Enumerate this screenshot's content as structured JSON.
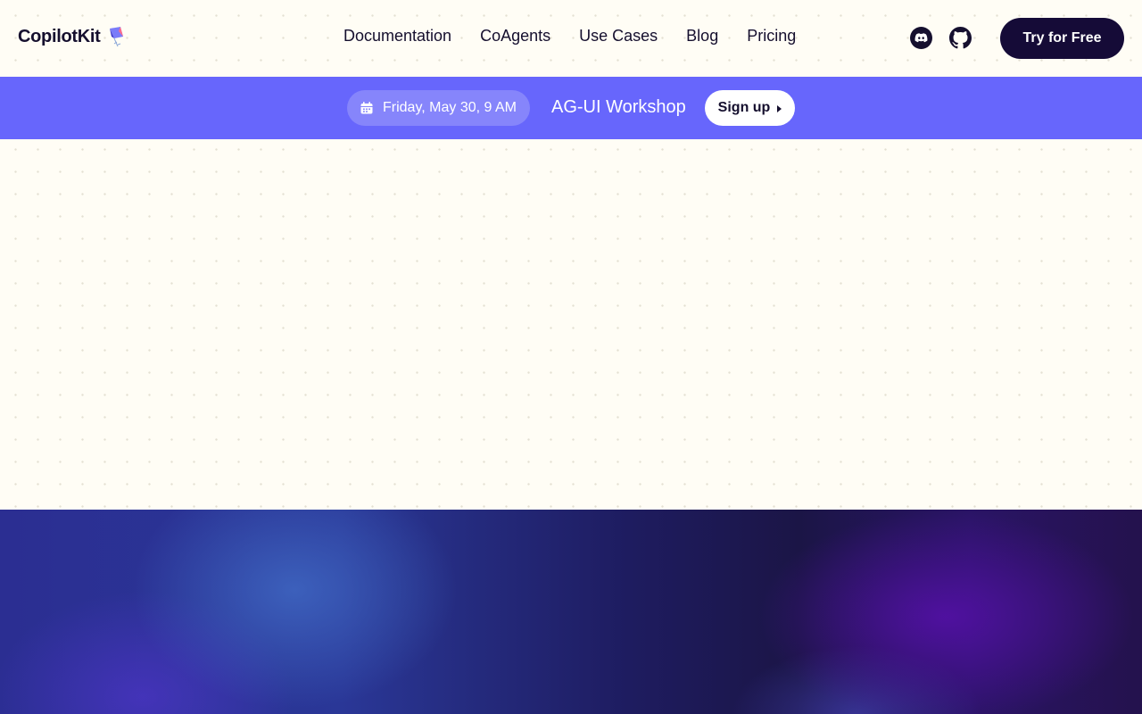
{
  "header": {
    "logo_text": "CopilotKit",
    "nav": [
      {
        "label": "Documentation"
      },
      {
        "label": "CoAgents"
      },
      {
        "label": "Use Cases"
      },
      {
        "label": "Blog"
      },
      {
        "label": "Pricing"
      }
    ],
    "social_icons": [
      "discord-icon",
      "github-icon"
    ],
    "cta_label": "Try for Free"
  },
  "banner": {
    "date": "Friday, May 30, 9 AM",
    "event_title": "AG-UI Workshop",
    "signup_label": "Sign up"
  },
  "colors": {
    "page_bg": "#fffdf5",
    "banner_bg": "#6766fc",
    "cta_bg": "#150b37",
    "text": "#150f2e"
  }
}
